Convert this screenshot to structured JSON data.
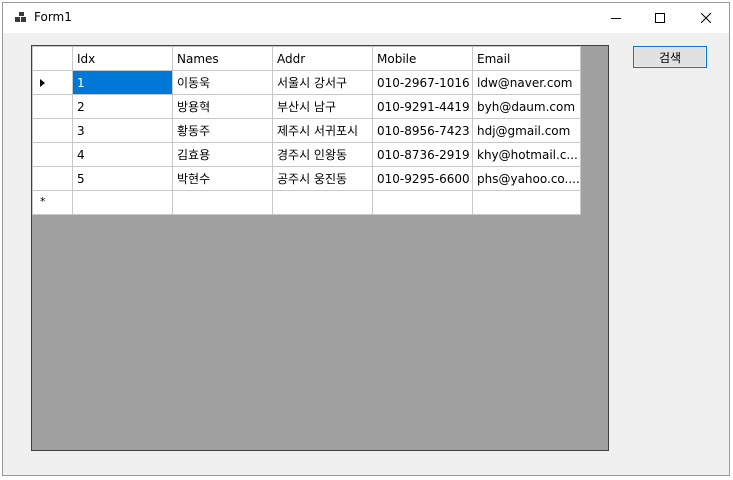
{
  "window": {
    "title": "Form1",
    "minimize_icon": "minimize-icon",
    "maximize_icon": "maximize-icon",
    "close_icon": "close-icon"
  },
  "search_button": {
    "label": "검색"
  },
  "grid": {
    "columns": [
      "Idx",
      "Names",
      "Addr",
      "Mobile",
      "Email"
    ],
    "rows": [
      {
        "idx": "1",
        "name": "이동욱",
        "addr": "서울시 강서구",
        "mobile": "010-2967-1016",
        "email": "ldw@naver.com"
      },
      {
        "idx": "2",
        "name": "방용혁",
        "addr": "부산시 남구",
        "mobile": "010-9291-4419",
        "email": "byh@daum.com"
      },
      {
        "idx": "3",
        "name": "황동주",
        "addr": "제주시 서귀포시",
        "mobile": "010-8956-7423",
        "email": "hdj@gmail.com"
      },
      {
        "idx": "4",
        "name": "김효용",
        "addr": "경주시 인왕동",
        "mobile": "010-8736-2919",
        "email": "khy@hotmail.c..."
      },
      {
        "idx": "5",
        "name": "박현수",
        "addr": "공주시 웅진동",
        "mobile": "010-9295-6600",
        "email": "phs@yahoo.co...."
      }
    ],
    "current_row_marker": "current-row-arrow-icon",
    "new_row_marker": "*"
  }
}
